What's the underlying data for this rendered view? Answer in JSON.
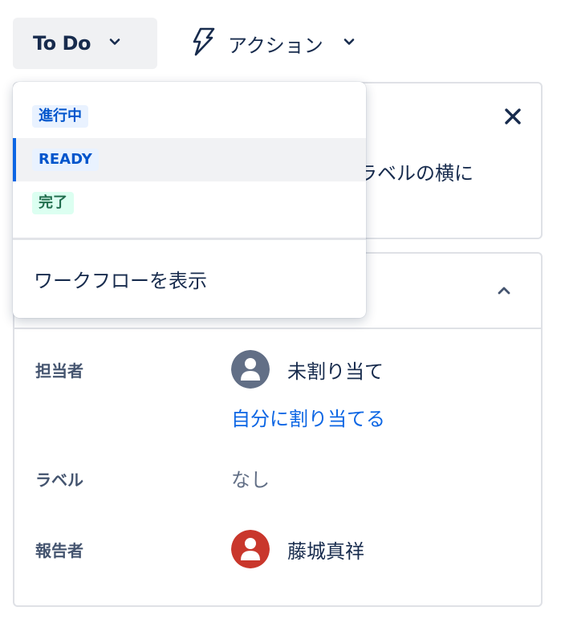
{
  "header": {
    "status_label": "To Do",
    "action_label": "アクション"
  },
  "dropdown": {
    "statuses": [
      {
        "label": "進行中",
        "color": "blue"
      },
      {
        "label": "READY",
        "color": "blue",
        "selected": true
      },
      {
        "label": "完了",
        "color": "green"
      }
    ],
    "workflow_label": "ワークフローを表示"
  },
  "info_card": {
    "partial_text": "ラベルの横に"
  },
  "details": {
    "assignee": {
      "label": "担当者",
      "value": "未割り当て",
      "assign_link": "自分に割り当てる"
    },
    "labels": {
      "label": "ラベル",
      "value": "なし"
    },
    "reporter": {
      "label": "報告者",
      "value": "藤城真祥"
    }
  },
  "colors": {
    "accent_blue": "#0c66e4",
    "avatar_unassigned": "#626f86",
    "avatar_reporter": "#c9372c"
  }
}
